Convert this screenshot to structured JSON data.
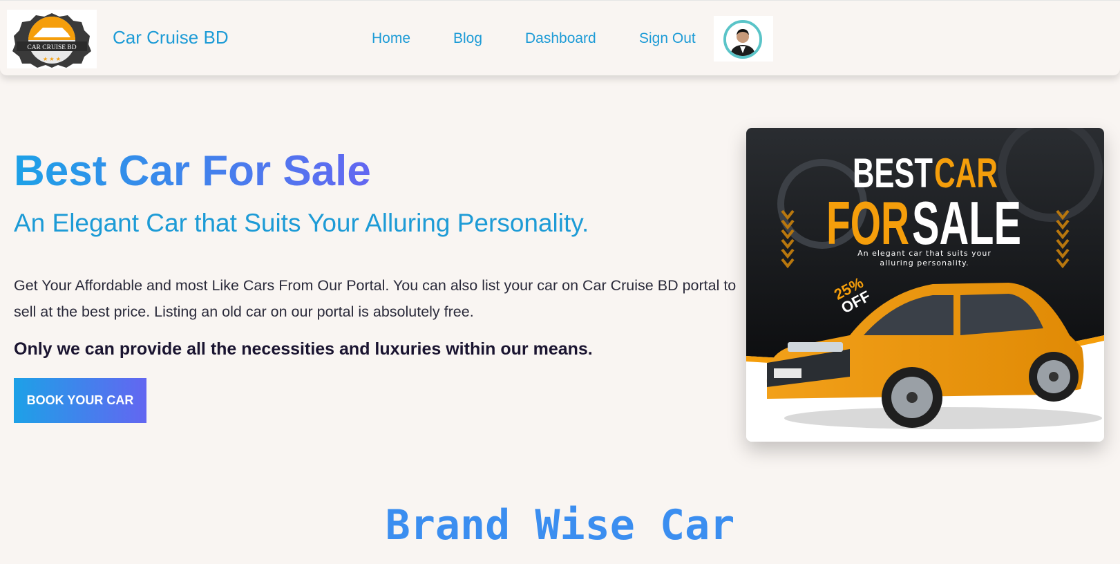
{
  "header": {
    "logo_text": "CAR CRUISE BD",
    "brand_name": "Car Cruise BD",
    "nav": [
      {
        "label": "Home"
      },
      {
        "label": "Blog"
      },
      {
        "label": "Dashboard"
      },
      {
        "label": "Sign Out"
      }
    ],
    "avatar_icon": "user-avatar"
  },
  "hero": {
    "title": "Best Car For Sale",
    "subtitle": "An Elegant Car that Suits Your Alluring Personality.",
    "paragraph": "Get Your Affordable and most Like Cars From Our Portal. You can also list your car on Car Cruise BD portal to sell at the best price. Listing an old car on our portal is absolutely free.",
    "tagline": "Only we can provide all the necessities and luxuries within our means.",
    "button_label": "BOOK YOUR CAR"
  },
  "promo": {
    "line1_a": "BEST",
    "line1_b": "CAR",
    "line2_a": "FOR",
    "line2_b": "SALE",
    "caption_1": "An elegant car that suits your",
    "caption_2": "alluring personality.",
    "discount_1": "25%",
    "discount_2": "OFF"
  },
  "section": {
    "title": "Brand Wise Car"
  },
  "colors": {
    "accent": "#1d9bd6",
    "gradient_start": "#1da1e7",
    "gradient_end": "#6366f1",
    "promo_orange": "#f59e0b",
    "background": "#f9f5f2"
  }
}
